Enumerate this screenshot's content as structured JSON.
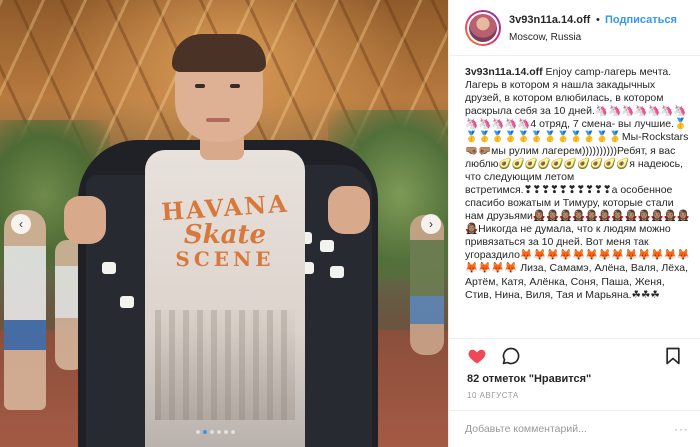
{
  "post": {
    "username": "3v93n11a.14.off",
    "separator": "•",
    "follow_label": "Подписаться",
    "location": "Moscow, Russia",
    "caption_author": "3v93n11a.14.off",
    "caption_text": " Enjoy camp-лагерь мечта. Лагерь в котором я нашла закадычных друзей, в котором влюбилась, в котором раскрыла себя за 10 дней.🦄🦄🦄🦄🦄🦄🦄🦄🦄🦄🦄🦄4 отряд, 7 смена- вы лучшие.🥇🥇🥇🥇🥇🥇🥇🥇🥇🥇🥇🥇🥇Мы-Rockstars 🤜🏽🤛🏽мы рулим лагерем))))))))))Ребят, я вас люблю🥑🥑🥑🥑🥑🥑🥑🥑🥑🥑я надеюсь, что следующим летом встретимся.❣❣❣❣❣❣❣❣❣❣а особенное спасибо вожатым и Тимуру, которые стали нам друзьями🧛🏽‍♀️🧛🏽‍♀️🧛🏽‍♀️🧛🏽‍♀️🧛🏽‍♀️🧛🏽‍♀️🧛🏽‍♀️🧛🏽‍♀️🧛🏽‍♀️🧛🏽‍♀️🧛🏽‍♀️🧛🏽‍♀️🧛🏽‍♀️Никогда не думала, что к людям можно привязаться за 10 дней. Вот меня так угораздило🦊🦊🦊🦊🦊🦊🦊🦊🦊🦊🦊🦊🦊🦊🦊🦊🦊 Лиза, Самамэ, Алёна, Валя, Лёха, Артём, Катя, Алёнка, Соня, Паша, Женя, Стив, Нина, Виля, Тая и Марьяна.☘☘☘",
    "likes": "82 отметок \"Нравится\"",
    "date": "10 АВГУСТА",
    "comment_placeholder": "Добавьте комментарий...",
    "more_label": "···"
  },
  "photo": {
    "shirt_line1": "HAVANA",
    "shirt_line2": "Skate",
    "shirt_line3": "SCENE",
    "prev_arrow": "‹",
    "next_arrow": "›",
    "slide_count": 6,
    "active_slide": 1
  },
  "icons": {
    "like": "heart-icon",
    "comment": "comment-bubble-icon",
    "save": "bookmark-icon"
  },
  "colors": {
    "accent": "#3897f0",
    "like": "#ed4956",
    "text": "#262626",
    "muted": "#999999",
    "divider": "#efefef",
    "shirt_print": "#d9783c"
  }
}
